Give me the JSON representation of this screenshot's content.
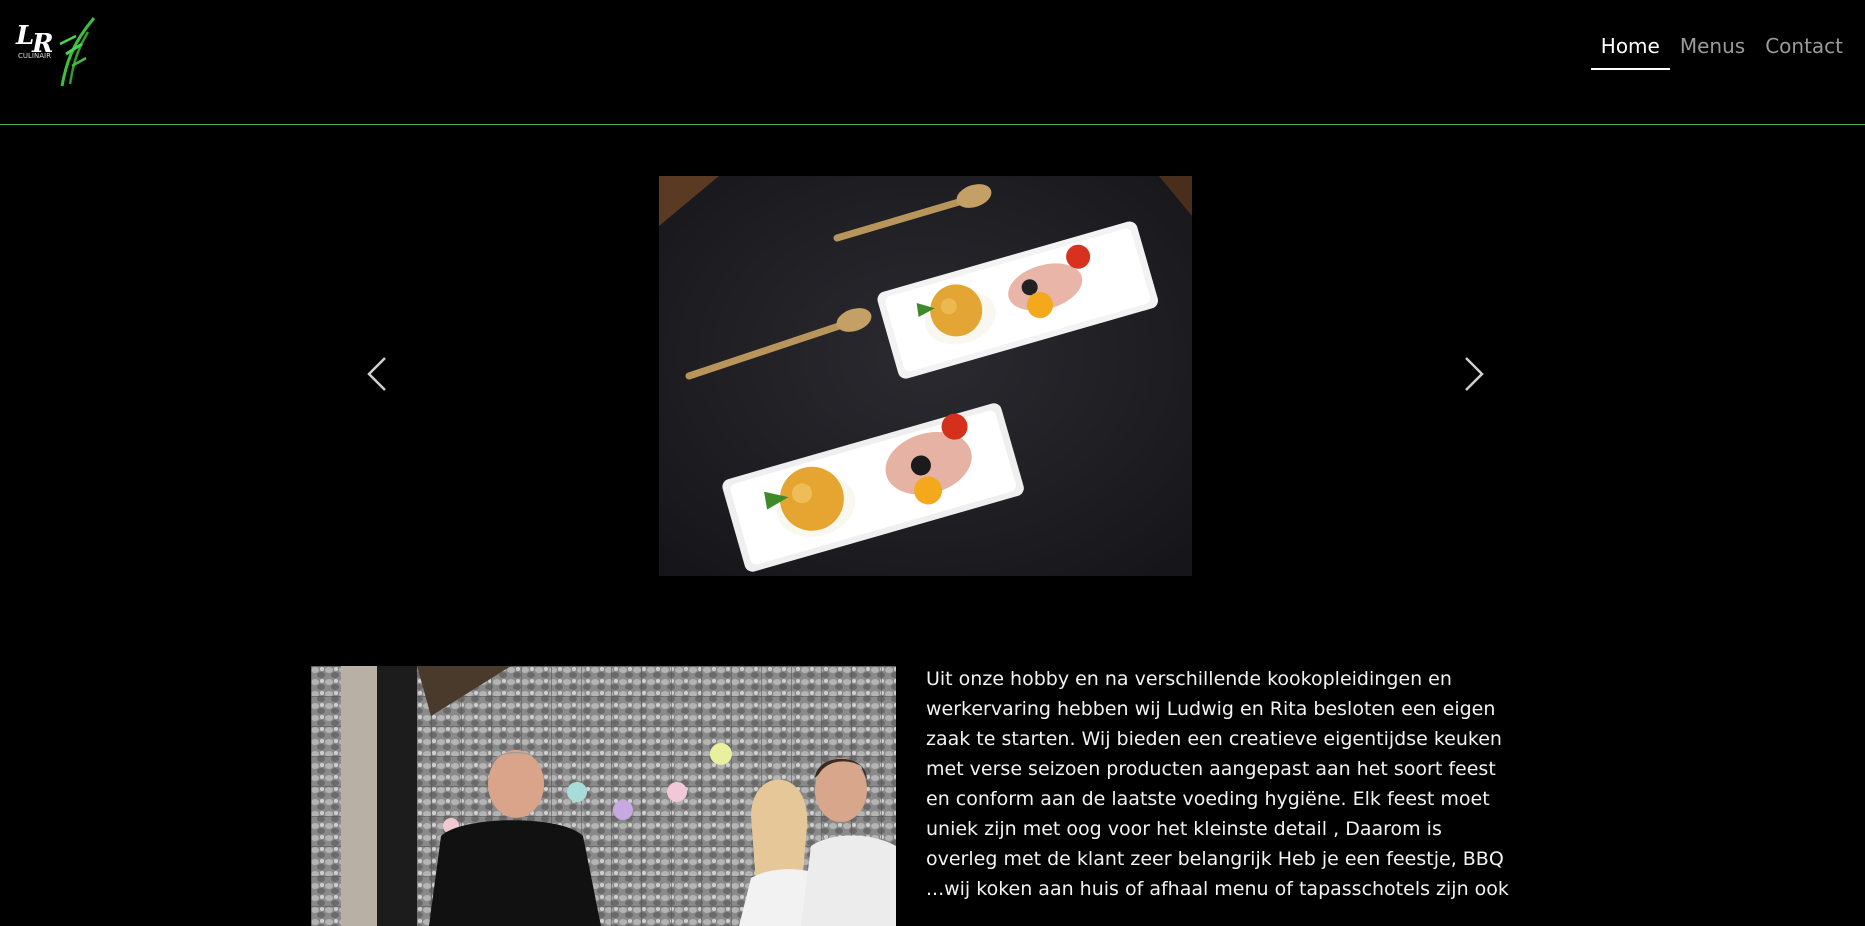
{
  "brand": {
    "logo_initials": "LR",
    "logo_subtitle": "CULINAIR",
    "accent_color": "#4caf50"
  },
  "nav": {
    "items": [
      {
        "label": "Home",
        "active": true
      },
      {
        "label": "Menus",
        "active": false
      },
      {
        "label": "Contact",
        "active": false
      }
    ]
  },
  "carousel": {
    "prev_icon": "chevron-left-icon",
    "next_icon": "chevron-right-icon",
    "slide_description": "tapas plates with croquette, ham and cherry tomato"
  },
  "about": {
    "text": "Uit onze hobby en na verschillende kookopleidingen en werkervaring hebben wij Ludwig en Rita besloten een eigen zaak te starten. Wij bieden een creatieve eigentijdse keuken met verse seizoen producten aangepast aan het soort feest en conform aan de laatste voeding hygiëne. Elk feest moet uniek zijn met oog voor het kleinste detail , Daarom is overleg met de klant zeer belangrijk Heb je een feestje, BBQ ...wij koken aan huis of afhaal menu of tapasschotels zijn ook"
  }
}
